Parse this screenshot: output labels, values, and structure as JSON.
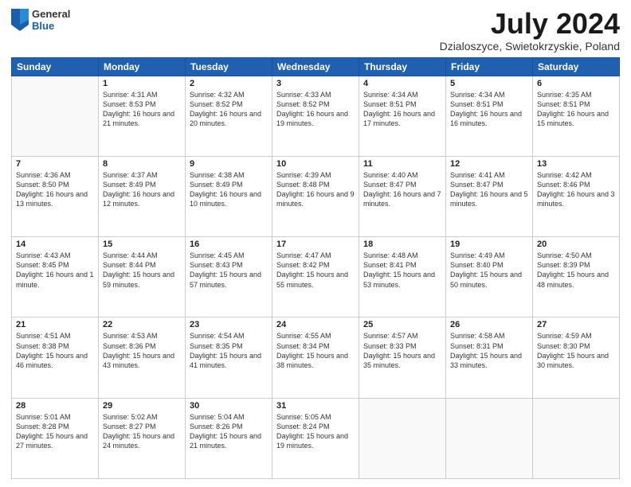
{
  "header": {
    "logo_general": "General",
    "logo_blue": "Blue",
    "month_year": "July 2024",
    "location": "Dzialoszyce, Swietokrzyskie, Poland"
  },
  "days_of_week": [
    "Sunday",
    "Monday",
    "Tuesday",
    "Wednesday",
    "Thursday",
    "Friday",
    "Saturday"
  ],
  "weeks": [
    [
      {
        "day": "",
        "sunrise": "",
        "sunset": "",
        "daylight": ""
      },
      {
        "day": "1",
        "sunrise": "Sunrise: 4:31 AM",
        "sunset": "Sunset: 8:53 PM",
        "daylight": "Daylight: 16 hours and 21 minutes."
      },
      {
        "day": "2",
        "sunrise": "Sunrise: 4:32 AM",
        "sunset": "Sunset: 8:52 PM",
        "daylight": "Daylight: 16 hours and 20 minutes."
      },
      {
        "day": "3",
        "sunrise": "Sunrise: 4:33 AM",
        "sunset": "Sunset: 8:52 PM",
        "daylight": "Daylight: 16 hours and 19 minutes."
      },
      {
        "day": "4",
        "sunrise": "Sunrise: 4:34 AM",
        "sunset": "Sunset: 8:51 PM",
        "daylight": "Daylight: 16 hours and 17 minutes."
      },
      {
        "day": "5",
        "sunrise": "Sunrise: 4:34 AM",
        "sunset": "Sunset: 8:51 PM",
        "daylight": "Daylight: 16 hours and 16 minutes."
      },
      {
        "day": "6",
        "sunrise": "Sunrise: 4:35 AM",
        "sunset": "Sunset: 8:51 PM",
        "daylight": "Daylight: 16 hours and 15 minutes."
      }
    ],
    [
      {
        "day": "7",
        "sunrise": "Sunrise: 4:36 AM",
        "sunset": "Sunset: 8:50 PM",
        "daylight": "Daylight: 16 hours and 13 minutes."
      },
      {
        "day": "8",
        "sunrise": "Sunrise: 4:37 AM",
        "sunset": "Sunset: 8:49 PM",
        "daylight": "Daylight: 16 hours and 12 minutes."
      },
      {
        "day": "9",
        "sunrise": "Sunrise: 4:38 AM",
        "sunset": "Sunset: 8:49 PM",
        "daylight": "Daylight: 16 hours and 10 minutes."
      },
      {
        "day": "10",
        "sunrise": "Sunrise: 4:39 AM",
        "sunset": "Sunset: 8:48 PM",
        "daylight": "Daylight: 16 hours and 9 minutes."
      },
      {
        "day": "11",
        "sunrise": "Sunrise: 4:40 AM",
        "sunset": "Sunset: 8:47 PM",
        "daylight": "Daylight: 16 hours and 7 minutes."
      },
      {
        "day": "12",
        "sunrise": "Sunrise: 4:41 AM",
        "sunset": "Sunset: 8:47 PM",
        "daylight": "Daylight: 16 hours and 5 minutes."
      },
      {
        "day": "13",
        "sunrise": "Sunrise: 4:42 AM",
        "sunset": "Sunset: 8:46 PM",
        "daylight": "Daylight: 16 hours and 3 minutes."
      }
    ],
    [
      {
        "day": "14",
        "sunrise": "Sunrise: 4:43 AM",
        "sunset": "Sunset: 8:45 PM",
        "daylight": "Daylight: 16 hours and 1 minute."
      },
      {
        "day": "15",
        "sunrise": "Sunrise: 4:44 AM",
        "sunset": "Sunset: 8:44 PM",
        "daylight": "Daylight: 15 hours and 59 minutes."
      },
      {
        "day": "16",
        "sunrise": "Sunrise: 4:45 AM",
        "sunset": "Sunset: 8:43 PM",
        "daylight": "Daylight: 15 hours and 57 minutes."
      },
      {
        "day": "17",
        "sunrise": "Sunrise: 4:47 AM",
        "sunset": "Sunset: 8:42 PM",
        "daylight": "Daylight: 15 hours and 55 minutes."
      },
      {
        "day": "18",
        "sunrise": "Sunrise: 4:48 AM",
        "sunset": "Sunset: 8:41 PM",
        "daylight": "Daylight: 15 hours and 53 minutes."
      },
      {
        "day": "19",
        "sunrise": "Sunrise: 4:49 AM",
        "sunset": "Sunset: 8:40 PM",
        "daylight": "Daylight: 15 hours and 50 minutes."
      },
      {
        "day": "20",
        "sunrise": "Sunrise: 4:50 AM",
        "sunset": "Sunset: 8:39 PM",
        "daylight": "Daylight: 15 hours and 48 minutes."
      }
    ],
    [
      {
        "day": "21",
        "sunrise": "Sunrise: 4:51 AM",
        "sunset": "Sunset: 8:38 PM",
        "daylight": "Daylight: 15 hours and 46 minutes."
      },
      {
        "day": "22",
        "sunrise": "Sunrise: 4:53 AM",
        "sunset": "Sunset: 8:36 PM",
        "daylight": "Daylight: 15 hours and 43 minutes."
      },
      {
        "day": "23",
        "sunrise": "Sunrise: 4:54 AM",
        "sunset": "Sunset: 8:35 PM",
        "daylight": "Daylight: 15 hours and 41 minutes."
      },
      {
        "day": "24",
        "sunrise": "Sunrise: 4:55 AM",
        "sunset": "Sunset: 8:34 PM",
        "daylight": "Daylight: 15 hours and 38 minutes."
      },
      {
        "day": "25",
        "sunrise": "Sunrise: 4:57 AM",
        "sunset": "Sunset: 8:33 PM",
        "daylight": "Daylight: 15 hours and 35 minutes."
      },
      {
        "day": "26",
        "sunrise": "Sunrise: 4:58 AM",
        "sunset": "Sunset: 8:31 PM",
        "daylight": "Daylight: 15 hours and 33 minutes."
      },
      {
        "day": "27",
        "sunrise": "Sunrise: 4:59 AM",
        "sunset": "Sunset: 8:30 PM",
        "daylight": "Daylight: 15 hours and 30 minutes."
      }
    ],
    [
      {
        "day": "28",
        "sunrise": "Sunrise: 5:01 AM",
        "sunset": "Sunset: 8:28 PM",
        "daylight": "Daylight: 15 hours and 27 minutes."
      },
      {
        "day": "29",
        "sunrise": "Sunrise: 5:02 AM",
        "sunset": "Sunset: 8:27 PM",
        "daylight": "Daylight: 15 hours and 24 minutes."
      },
      {
        "day": "30",
        "sunrise": "Sunrise: 5:04 AM",
        "sunset": "Sunset: 8:26 PM",
        "daylight": "Daylight: 15 hours and 21 minutes."
      },
      {
        "day": "31",
        "sunrise": "Sunrise: 5:05 AM",
        "sunset": "Sunset: 8:24 PM",
        "daylight": "Daylight: 15 hours and 19 minutes."
      },
      {
        "day": "",
        "sunrise": "",
        "sunset": "",
        "daylight": ""
      },
      {
        "day": "",
        "sunrise": "",
        "sunset": "",
        "daylight": ""
      },
      {
        "day": "",
        "sunrise": "",
        "sunset": "",
        "daylight": ""
      }
    ]
  ]
}
